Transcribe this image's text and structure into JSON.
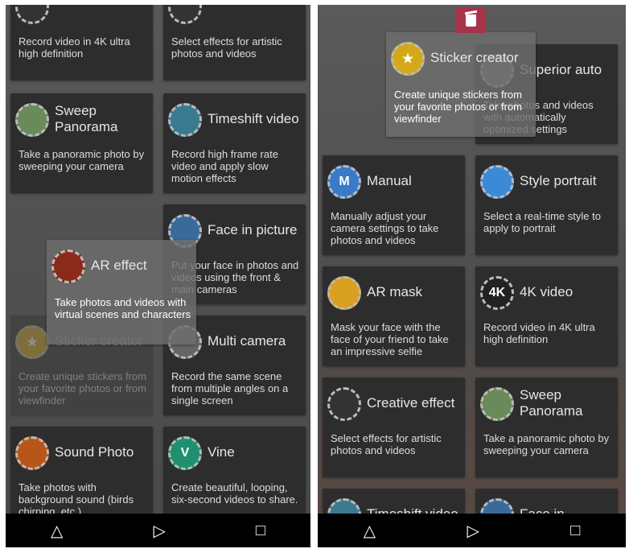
{
  "left": {
    "cards": [
      {
        "title": "",
        "desc": "Record video in 4K ultra high definition",
        "icon": "4k-video-icon",
        "color": "#333"
      },
      {
        "title": "",
        "desc": "Select effects for artistic photos and videos",
        "icon": "creative-effect-icon",
        "color": "#333"
      },
      {
        "title": "Sweep Panorama",
        "desc": "Take a panoramic photo by sweeping your camera",
        "icon": "panorama-icon",
        "color": "#6a8a5a"
      },
      {
        "title": "Timeshift video",
        "desc": "Record high frame rate video and apply slow motion effects",
        "icon": "hummingbird-icon",
        "color": "#3a7a90"
      },
      {
        "title": "Face in picture",
        "desc": "Put your face in photos and videos using the front & main cameras",
        "icon": "face-in-picture-icon",
        "color": "#3a6a9a"
      },
      {
        "title": "Sticker creator",
        "desc": "Create unique stickers from your favorite photos or from viewfinder",
        "icon": "sticker-icon",
        "color": "#d4a817"
      },
      {
        "title": "Multi camera",
        "desc": "Record the same scene from multiple angles on a single screen",
        "icon": "multi-camera-icon",
        "color": "#666"
      },
      {
        "title": "Sound Photo",
        "desc": "Take photos with background sound (birds chirping, etc.)",
        "icon": "sound-photo-icon",
        "color": "#b8561a"
      },
      {
        "title": "Vine",
        "desc": "Create beautiful, looping, six-second videos to share.",
        "icon": "vine-icon",
        "color": "#1f8f70"
      }
    ],
    "dragged": {
      "title": "AR effect",
      "desc": "Take photos and videos with virtual scenes and characters",
      "icon": "dinosaur-icon",
      "color": "#8a2a1a"
    }
  },
  "right": {
    "cards": [
      {
        "title": "Superior auto",
        "desc": "Take photos and videos with automatically optimized settings",
        "icon": "camera-icon",
        "color": "#777"
      },
      {
        "title": "Manual",
        "desc": "Manually adjust your camera settings to take photos and videos",
        "icon": "manual-m-icon",
        "color": "#3a7ac8"
      },
      {
        "title": "Style portrait",
        "desc": "Select a real-time style to apply to portrait",
        "icon": "style-portrait-icon",
        "color": "#3a8ad8"
      },
      {
        "title": "AR mask",
        "desc": "Mask your face with the face of your friend to take an impressive selfie",
        "icon": "ar-mask-icon",
        "color": "#d8a020"
      },
      {
        "title": "4K video",
        "desc": "Record video in 4K ultra high definition",
        "icon": "4k-icon",
        "color": "#222"
      },
      {
        "title": "Creative effect",
        "desc": "Select effects for artistic photos and videos",
        "icon": "palette-icon",
        "color": "#333"
      },
      {
        "title": "Sweep Panorama",
        "desc": "Take a panoramic photo by sweeping your camera",
        "icon": "panorama-icon",
        "color": "#6a8a5a"
      },
      {
        "title": "Timeshift video",
        "desc": "",
        "icon": "hummingbird-icon",
        "color": "#3a7a90"
      },
      {
        "title": "Face in",
        "desc": "",
        "icon": "face-in-picture-icon",
        "color": "#3a6a9a"
      }
    ],
    "dragged": {
      "title": "Sticker creator",
      "desc": "Create unique stickers from your favorite photos or from viewfinder",
      "icon": "sticker-icon",
      "color": "#d4a817"
    },
    "trash_color": "#a8334a"
  },
  "nav": {
    "back": "△",
    "home": "▷",
    "recents": "□"
  },
  "icon_glyphs": {
    "manual-m-icon": "M",
    "4k-icon": "4K",
    "vine-icon": "V",
    "sticker-icon": "★"
  }
}
